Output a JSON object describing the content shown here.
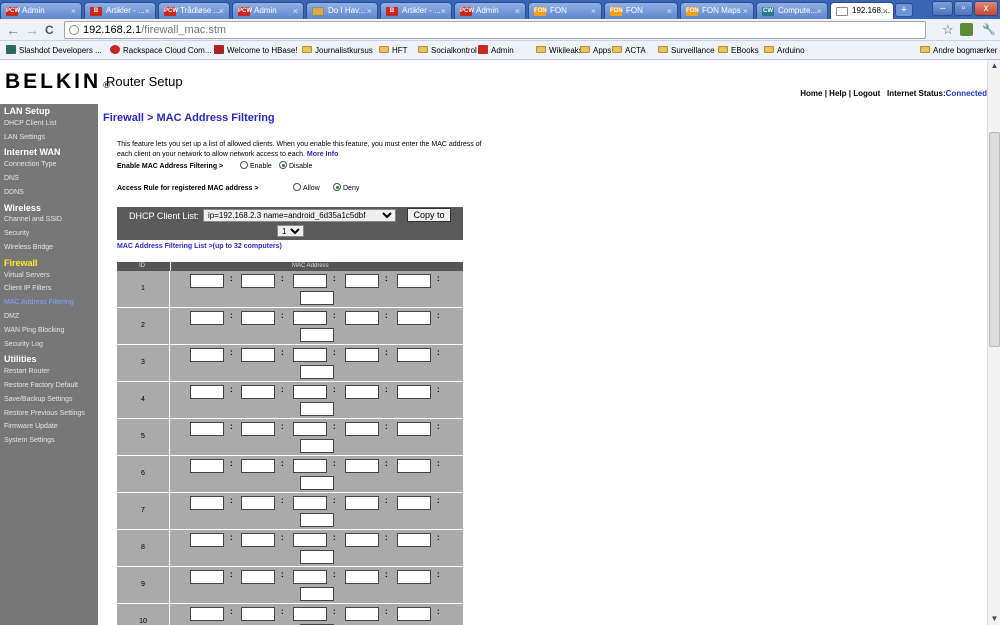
{
  "browser": {
    "tabs": [
      {
        "title": "Admin",
        "icon": "red-admin-icon",
        "color": "#c8281e"
      },
      {
        "title": "Artikler - ...",
        "icon": "red-logo-icon",
        "color": "#c8281e"
      },
      {
        "title": "Trådløse ...",
        "icon": "red-admin-icon",
        "color": "#c8281e"
      },
      {
        "title": "Admin",
        "icon": "red-admin-icon",
        "color": "#c8281e"
      },
      {
        "title": "Do I Hav...",
        "icon": "page-icon",
        "color": "#d8a84a"
      },
      {
        "title": "Artikler - ...",
        "icon": "red-logo-icon",
        "color": "#c8281e"
      },
      {
        "title": "Admin",
        "icon": "red-admin-icon",
        "color": "#c8281e"
      },
      {
        "title": "FON",
        "icon": "fon-icon",
        "color": "#f2a020"
      },
      {
        "title": "FON",
        "icon": "fon-icon",
        "color": "#f2a020"
      },
      {
        "title": "FON Maps",
        "icon": "fon-icon",
        "color": "#f2a020"
      },
      {
        "title": "Compute...",
        "icon": "cw-icon",
        "color": "#2a7a8a"
      },
      {
        "title": "192.168....",
        "icon": "page-icon",
        "color": "#ffffff"
      }
    ],
    "tab_abbr": {
      "admin": "PCW",
      "logo": "B",
      "fon": "FON",
      "cw": "CW"
    },
    "new_tab": "+",
    "window_buttons": {
      "minimize": "–",
      "maximize": "▫",
      "close": "x"
    },
    "nav": {
      "back": "←",
      "forward": "→",
      "reload": "C"
    },
    "url_host": "192.168.2.1",
    "url_path": "/firewall_mac.stm",
    "toolbar_icons": {
      "star": "☆",
      "wrench": "🔧"
    },
    "bookmarks": [
      {
        "label": "Slashdot Developers ...",
        "icon": "slashdot-icon"
      },
      {
        "label": "Rackspace Cloud Com...",
        "icon": "rackspace-icon"
      },
      {
        "label": "Welcome to HBase!",
        "icon": "hbase-icon"
      },
      {
        "label": "Journalistkursus",
        "icon": "folder-icon"
      },
      {
        "label": "HFT",
        "icon": "folder-icon"
      },
      {
        "label": "Socialkontrol",
        "icon": "folder-icon"
      },
      {
        "label": "Admin",
        "icon": "red-admin-icon"
      },
      {
        "label": "Wikileaks",
        "icon": "folder-icon"
      },
      {
        "label": "Apps",
        "icon": "folder-icon"
      },
      {
        "label": "ACTA",
        "icon": "folder-icon"
      },
      {
        "label": "Surveillance",
        "icon": "folder-icon"
      },
      {
        "label": "EBooks",
        "icon": "folder-icon"
      },
      {
        "label": "Arduino",
        "icon": "folder-icon"
      }
    ],
    "other_bookmarks": "Andre bogmærker",
    "scroll_arrows": {
      "up": "▲",
      "down": "▼"
    }
  },
  "header": {
    "brand": "BELKIN",
    "brand_mark": "®",
    "product": "Router Setup",
    "links": {
      "home": "Home",
      "sep": " | ",
      "help": "Help",
      "logout": "Logout"
    },
    "internet_status_label": "Internet Status:",
    "internet_status_value": "Connected"
  },
  "sidebar": [
    {
      "label": "LAN Setup",
      "type": "header"
    },
    {
      "label": "DHCP Client List",
      "type": "item"
    },
    {
      "label": "LAN Settings",
      "type": "item"
    },
    {
      "label": "Internet WAN",
      "type": "header"
    },
    {
      "label": "Connection Type",
      "type": "item"
    },
    {
      "label": "DNS",
      "type": "item"
    },
    {
      "label": "DDNS",
      "type": "item"
    },
    {
      "label": "Wireless",
      "type": "header"
    },
    {
      "label": "Channel and SSID",
      "type": "item"
    },
    {
      "label": "Security",
      "type": "item"
    },
    {
      "label": "Wireless Bridge",
      "type": "item"
    },
    {
      "label": "Firewall",
      "type": "header-active"
    },
    {
      "label": "Virtual Servers",
      "type": "item"
    },
    {
      "label": "Client IP Filters",
      "type": "item"
    },
    {
      "label": "MAC Address Filtering",
      "type": "selected"
    },
    {
      "label": "DMZ",
      "type": "item"
    },
    {
      "label": "WAN Ping Blocking",
      "type": "item"
    },
    {
      "label": "Security Log",
      "type": "item"
    },
    {
      "label": "Utilities",
      "type": "header"
    },
    {
      "label": "Restart Router",
      "type": "item"
    },
    {
      "label": "Restore Factory Default",
      "type": "item"
    },
    {
      "label": "Save/Backup Settings",
      "type": "item"
    },
    {
      "label": "Restore Previous Settings",
      "type": "item"
    },
    {
      "label": "Firmware Update",
      "type": "item"
    },
    {
      "label": "System Settings",
      "type": "item"
    }
  ],
  "main": {
    "title": "Firewall > MAC Address Filtering",
    "intro": "This feature lets you set up a list of allowed clients. When you enable this feature, you must enter the MAC address of each client on your network to allow network access to each.",
    "more_info": "More Info",
    "enable_label": "Enable MAC Address Filtering >",
    "enable_options": {
      "enable": "Enable",
      "disable": "Disable",
      "selected": "disable"
    },
    "access_label": "Access Rule for registered MAC address >",
    "access_options": {
      "allow": "Allow",
      "deny": "Deny",
      "selected": "deny"
    },
    "dhcp_label": "DHCP Client List:",
    "dhcp_selected": "ip=192.168.2.3 name=android_6d35a1c5dbf",
    "copy_button": "Copy to",
    "slot_selected": "1",
    "list_title": "MAC Address Filtering List >(up to 32 computers)",
    "table_headers": {
      "id": "ID",
      "mac": "MAC Address"
    },
    "rows": [
      "1",
      "2",
      "3",
      "4",
      "5",
      "6",
      "7",
      "8",
      "9",
      "10"
    ],
    "separator": ":"
  },
  "colors": {
    "accent_blue": "#2a2ac8",
    "connected": "#1c35d0",
    "sidebar_bg": "#777777",
    "firewall_active": "#ffea2a",
    "selected_item": "#7fa4ff",
    "table_row": "#aaaaaa",
    "dhcp_bar": "#5a5a5a"
  }
}
